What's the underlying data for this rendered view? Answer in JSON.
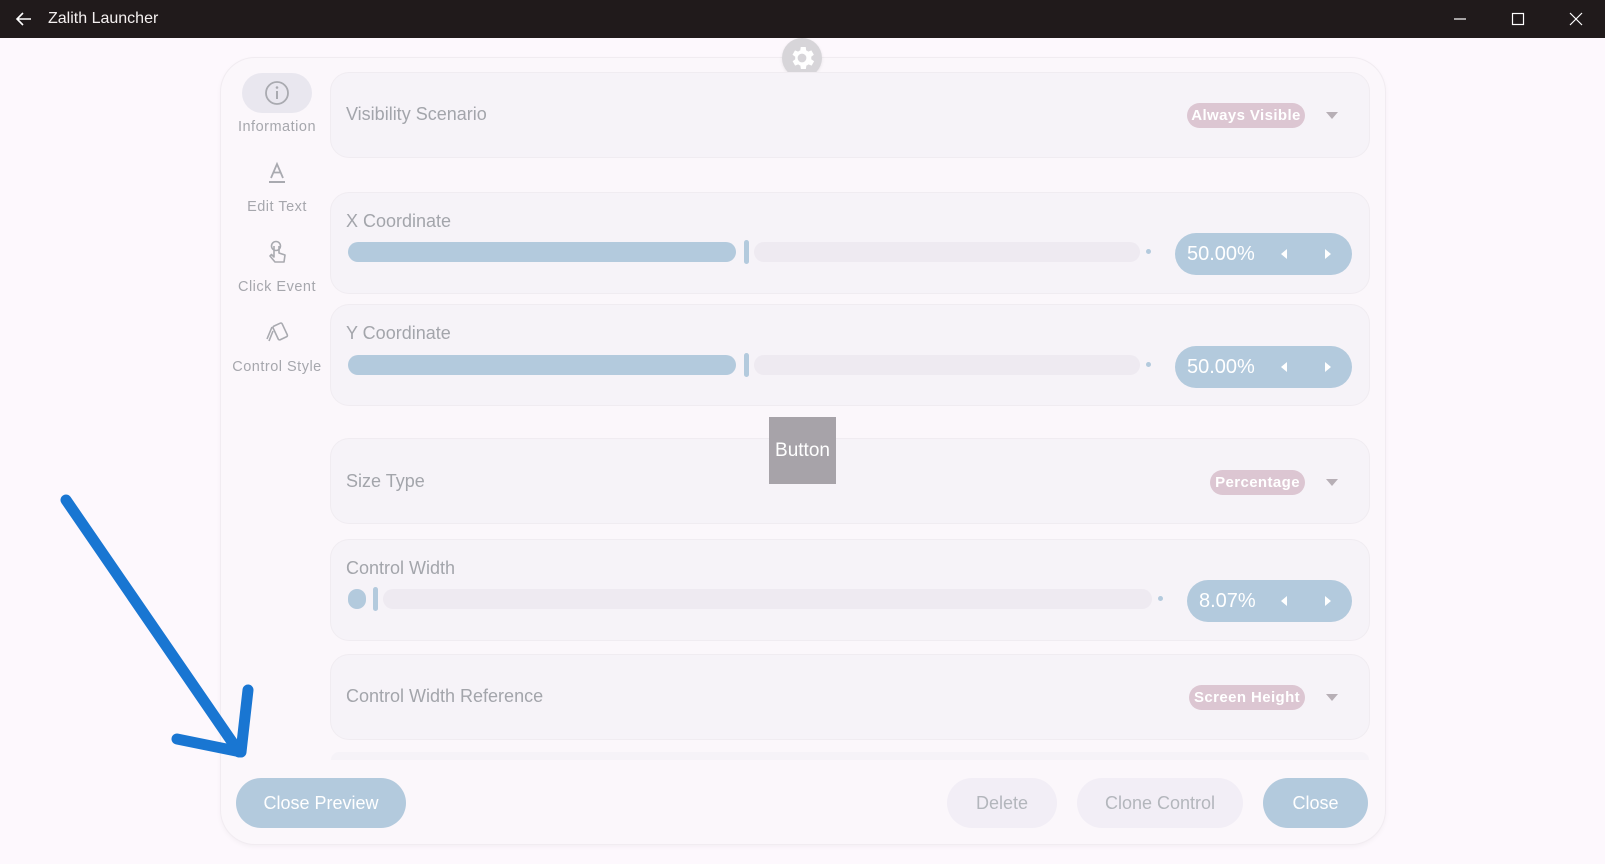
{
  "window": {
    "title": "Zalith Launcher"
  },
  "sidebar": {
    "items": [
      {
        "label": "Information",
        "icon": "info-icon",
        "active": true
      },
      {
        "label": "Edit Text",
        "icon": "text-format-icon",
        "active": false
      },
      {
        "label": "Click Event",
        "icon": "touch-icon",
        "active": false
      },
      {
        "label": "Control Style",
        "icon": "style-icon",
        "active": false
      }
    ]
  },
  "settings": {
    "visibility": {
      "label": "Visibility Scenario",
      "value": "Always Visible"
    },
    "x_coordinate": {
      "label": "X Coordinate",
      "value_text": "50.00%",
      "value": 0.5
    },
    "y_coordinate": {
      "label": "Y Coordinate",
      "value_text": "50.00%",
      "value": 0.5
    },
    "size_type": {
      "label": "Size Type",
      "value": "Percentage"
    },
    "control_width": {
      "label": "Control Width",
      "value_text": "8.07%",
      "value": 0.0807
    },
    "width_reference": {
      "label": "Control Width Reference",
      "value": "Screen Height"
    }
  },
  "preview": {
    "button_label": "Button"
  },
  "footer": {
    "close_preview": "Close Preview",
    "delete": "Delete",
    "clone_control": "Clone Control",
    "close": "Close"
  },
  "colors": {
    "primary": "#b3cadd",
    "chip": "#dcc6d2",
    "titlebar": "#201a1b",
    "annotation_arrow": "#1976d2"
  }
}
